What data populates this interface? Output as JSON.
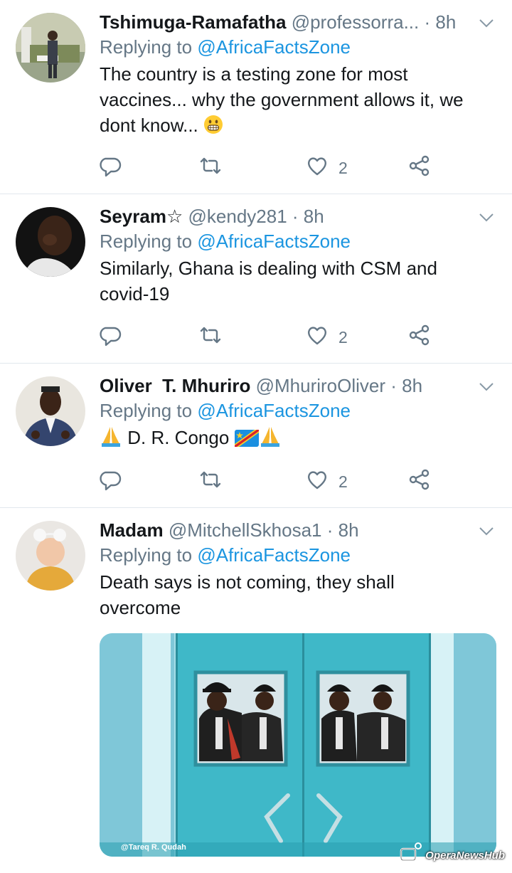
{
  "colors": {
    "link": "#1b95e0",
    "muted": "#657786",
    "text": "#14171a",
    "divider": "#e1e8ed"
  },
  "tweets": [
    {
      "name": "Tshimuga-Ramafatha",
      "handle": "@professorra...",
      "time": "· 8h",
      "replying_prefix": "Replying to",
      "replying_handle": "@AfricaFactsZone",
      "text_lines": [
        "The country is a testing zone for most",
        "vaccines... why the government allows it, we",
        "dont know..."
      ],
      "like_count": "2"
    },
    {
      "name": "Seyram",
      "name_suffix": "☆",
      "handle": "@kendy281",
      "time": "· 8h",
      "replying_prefix": "Replying to",
      "replying_handle": "@AfricaFactsZone",
      "text_lines": [
        "Similarly, Ghana is dealing with CSM and",
        "covid-19"
      ],
      "like_count": "2"
    },
    {
      "name": "Oliver  T. Mhuriro",
      "handle": "@MhuriroOliver",
      "time": "· 8h",
      "replying_prefix": "Replying to",
      "replying_handle": "@AfricaFactsZone",
      "text_lines": [
        "D. R. Congo"
      ],
      "like_count": "2"
    },
    {
      "name": "Madam",
      "handle": "@MitchellSkhosa1",
      "time": "· 8h",
      "replying_prefix": "Replying to",
      "replying_handle": "@AfricaFactsZone",
      "text_lines": [
        "Death says is not coming, they shall",
        "overcome"
      ],
      "image_credit": "@Tareq R. Qudah"
    }
  ],
  "watermark": "OperaNewsHub"
}
